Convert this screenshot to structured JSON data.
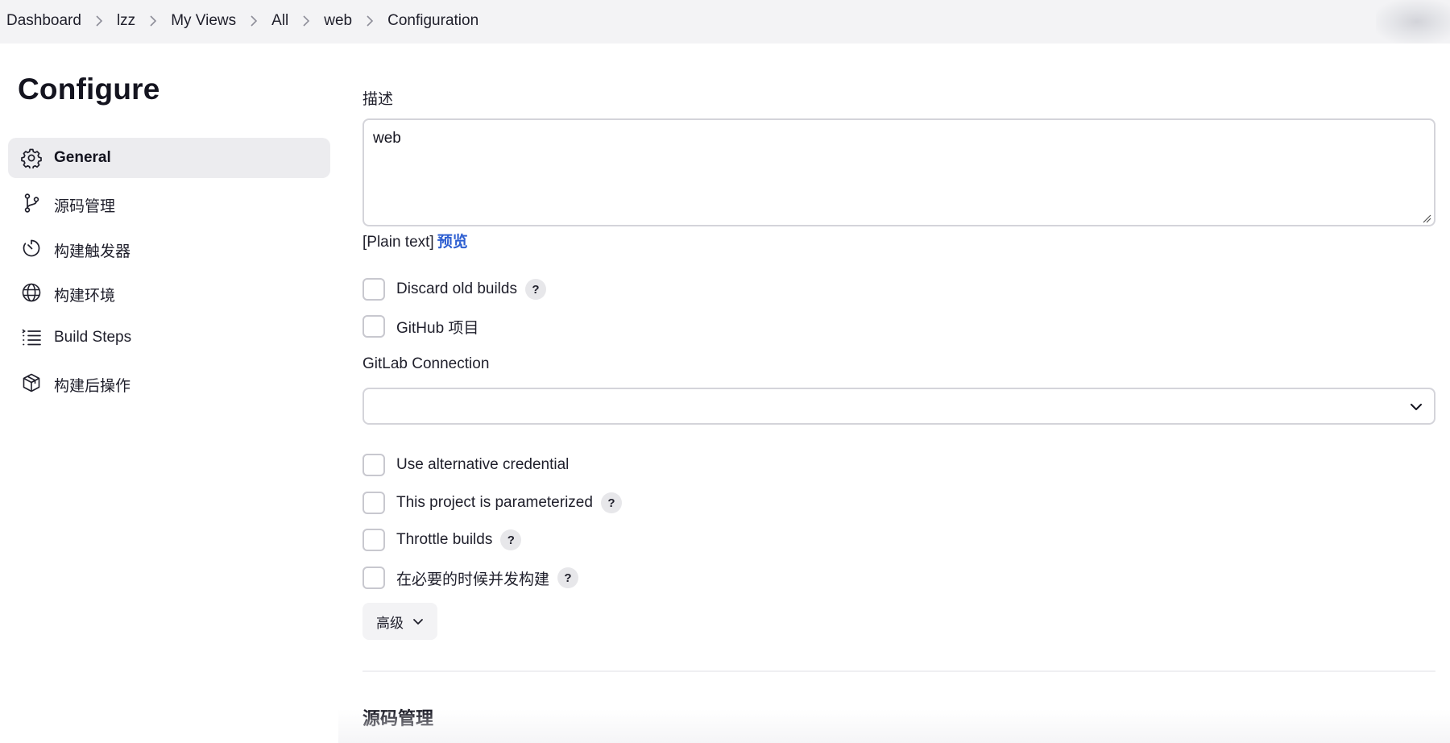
{
  "breadcrumb": {
    "items": [
      {
        "label": "Dashboard"
      },
      {
        "label": "lzz"
      },
      {
        "label": "My Views"
      },
      {
        "label": "All"
      },
      {
        "label": "web"
      },
      {
        "label": "Configuration"
      }
    ]
  },
  "sidebar": {
    "title": "Configure",
    "items": [
      {
        "label": "General",
        "icon": "gear-icon",
        "active": true
      },
      {
        "label": "源码管理",
        "icon": "branch-icon"
      },
      {
        "label": "构建触发器",
        "icon": "timer-icon"
      },
      {
        "label": "构建环境",
        "icon": "globe-icon"
      },
      {
        "label": "Build Steps",
        "icon": "list-icon"
      },
      {
        "label": "构建后操作",
        "icon": "package-icon"
      }
    ]
  },
  "general": {
    "description_label": "描述",
    "description_value": "web",
    "plain_text": "[Plain text]",
    "preview_label": "预览",
    "options": [
      {
        "label": "Discard old builds",
        "checked": false,
        "help": "?"
      },
      {
        "label": "GitHub 项目",
        "checked": false
      },
      {
        "label": "Use alternative credential",
        "checked": false
      },
      {
        "label": "This project is parameterized",
        "checked": false,
        "help": "?"
      },
      {
        "label": "Throttle builds",
        "checked": false,
        "help": "?"
      },
      {
        "label": "在必要的时候并发构建",
        "checked": false,
        "help": "?"
      }
    ],
    "gitlab_connection_label": "GitLab Connection",
    "gitlab_connection_value": "",
    "advanced_label": "高级"
  },
  "scm_section": {
    "heading": "源码管理"
  },
  "colors": {
    "accent_link": "#2e5fd1",
    "active_nav_bg": "#ececef",
    "topbar_bg": "#f3f3f5"
  }
}
